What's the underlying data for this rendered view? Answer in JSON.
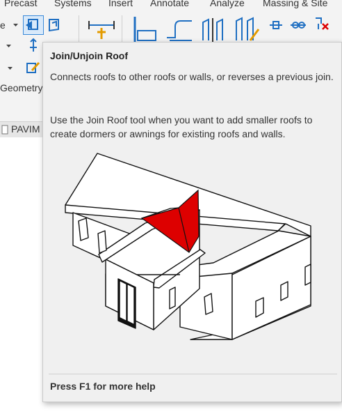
{
  "ribbon": {
    "tabs": [
      "Precast",
      "Systems",
      "Insert",
      "Annotate",
      "Analyze",
      "Massing & Site"
    ],
    "left_fragment": "e",
    "geometry_label": "Geometry"
  },
  "view_tab": {
    "label": "PAVIM"
  },
  "tooltip": {
    "title": "Join/Unjoin Roof",
    "description": "Connects roofs to other roofs or walls, or reverses a previous join.",
    "usage": "Use the Join Roof tool when you want to add smaller roofs to create dormers or awnings for existing roofs and walls.",
    "footer": "Press F1 for more help",
    "accent_color": "#dd0000"
  }
}
